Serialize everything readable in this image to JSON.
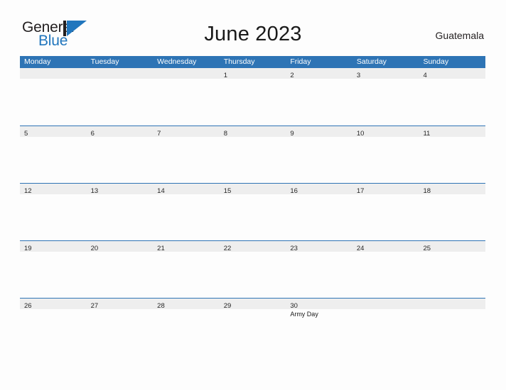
{
  "brand": {
    "word_one": "General",
    "word_two": "Blue",
    "mark_icon": "blue-triangle-flag-icon",
    "accent_color": "#2176bd"
  },
  "header": {
    "title": "June 2023",
    "country": "Guatemala"
  },
  "calendar": {
    "header_color": "#2e74b5",
    "band_color": "#eeeeee",
    "weekdays": [
      "Monday",
      "Tuesday",
      "Wednesday",
      "Thursday",
      "Friday",
      "Saturday",
      "Sunday"
    ],
    "weeks": [
      [
        {
          "day": "",
          "events": []
        },
        {
          "day": "",
          "events": []
        },
        {
          "day": "",
          "events": []
        },
        {
          "day": "1",
          "events": []
        },
        {
          "day": "2",
          "events": []
        },
        {
          "day": "3",
          "events": []
        },
        {
          "day": "4",
          "events": []
        }
      ],
      [
        {
          "day": "5",
          "events": []
        },
        {
          "day": "6",
          "events": []
        },
        {
          "day": "7",
          "events": []
        },
        {
          "day": "8",
          "events": []
        },
        {
          "day": "9",
          "events": []
        },
        {
          "day": "10",
          "events": []
        },
        {
          "day": "11",
          "events": []
        }
      ],
      [
        {
          "day": "12",
          "events": []
        },
        {
          "day": "13",
          "events": []
        },
        {
          "day": "14",
          "events": []
        },
        {
          "day": "15",
          "events": []
        },
        {
          "day": "16",
          "events": []
        },
        {
          "day": "17",
          "events": []
        },
        {
          "day": "18",
          "events": []
        }
      ],
      [
        {
          "day": "19",
          "events": []
        },
        {
          "day": "20",
          "events": []
        },
        {
          "day": "21",
          "events": []
        },
        {
          "day": "22",
          "events": []
        },
        {
          "day": "23",
          "events": []
        },
        {
          "day": "24",
          "events": []
        },
        {
          "day": "25",
          "events": []
        }
      ],
      [
        {
          "day": "26",
          "events": []
        },
        {
          "day": "27",
          "events": []
        },
        {
          "day": "28",
          "events": []
        },
        {
          "day": "29",
          "events": []
        },
        {
          "day": "30",
          "events": [
            "Army Day"
          ]
        },
        {
          "day": "",
          "events": []
        },
        {
          "day": "",
          "events": []
        }
      ]
    ]
  }
}
